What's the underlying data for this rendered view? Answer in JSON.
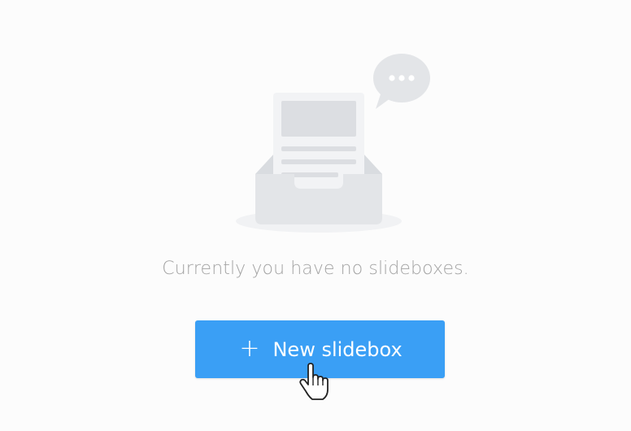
{
  "empty_state": {
    "icon": "inbox-tray-icon",
    "bubble_icon": "speech-bubble-icon",
    "message": "Currently you have no slideboxes."
  },
  "new_button": {
    "icon": "plus-icon",
    "plus": "+",
    "label": "New slidebox"
  },
  "cursor": {
    "icon": "hand-pointer-icon"
  },
  "colors": {
    "accent": "#3a9ff5",
    "message_text": "#a3a3a3",
    "illustration_gray": "#e3e5e8",
    "background": "#fcfcfc"
  }
}
